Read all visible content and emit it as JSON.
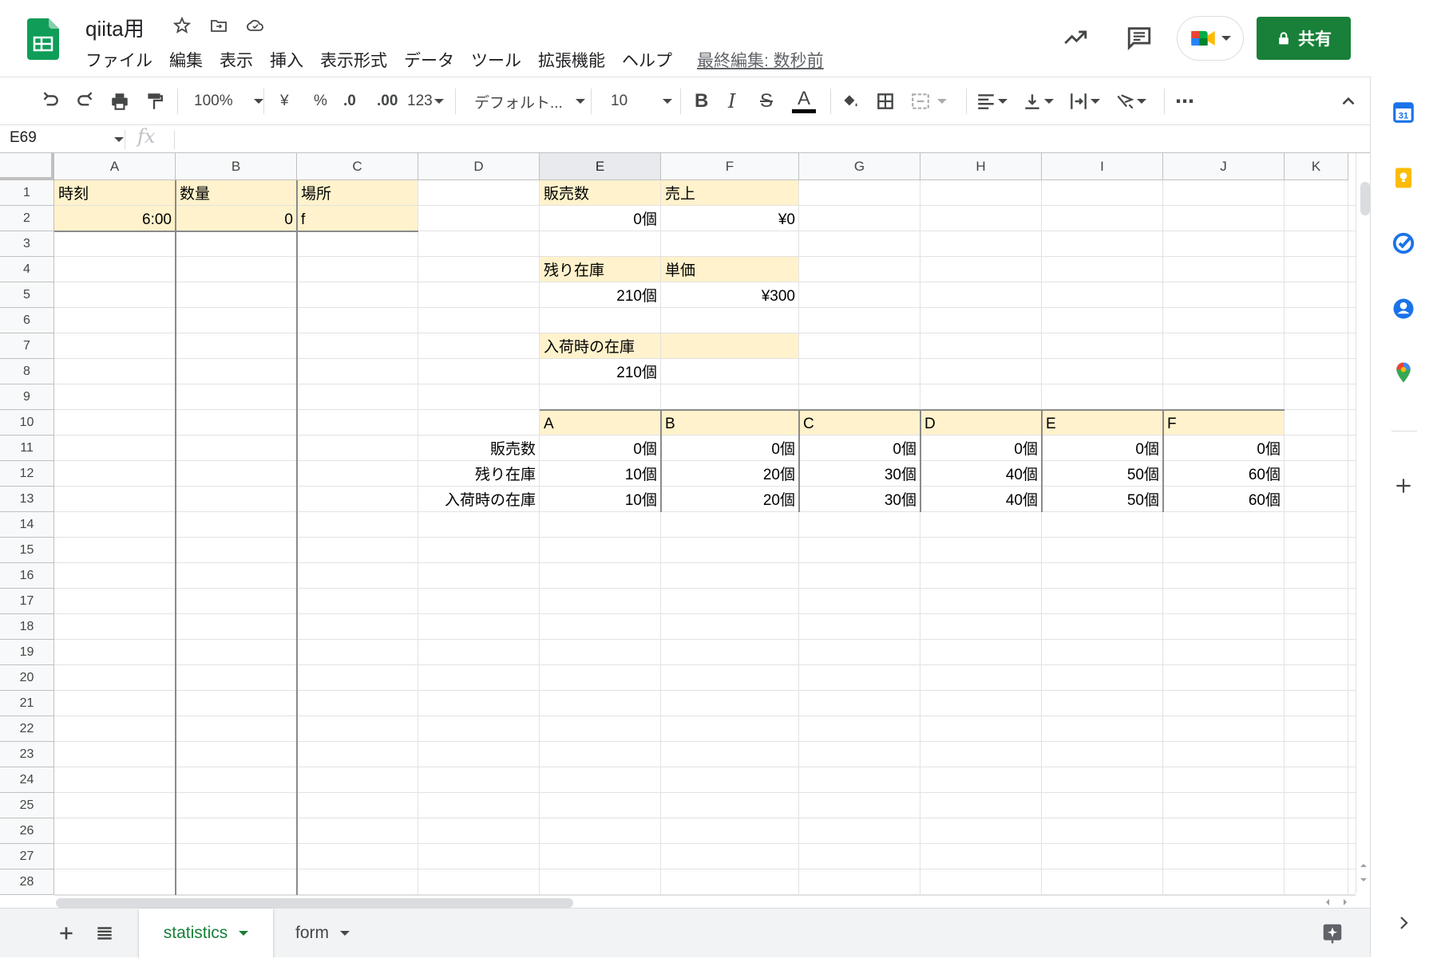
{
  "doc": {
    "title": "qiita用",
    "menu": [
      "ファイル",
      "編集",
      "表示",
      "挿入",
      "表示形式",
      "データ",
      "ツール",
      "拡張機能",
      "ヘルプ"
    ],
    "last_edit": "最終編集: 数秒前",
    "share_label": "共有"
  },
  "toolbar": {
    "zoom": "100%",
    "currency": "¥",
    "percent": "%",
    "dec_decrease": ".0",
    "dec_increase": ".00",
    "number_format": "123",
    "font": "デフォルト...",
    "font_size": "10",
    "bold": "B",
    "italic": "I",
    "strike": "S",
    "text_color": "A",
    "more": "⋯"
  },
  "formula_bar": {
    "cell_ref": "E69",
    "fx": "fx"
  },
  "columns": [
    "A",
    "B",
    "C",
    "D",
    "E",
    "F",
    "G",
    "H",
    "I",
    "J",
    "K"
  ],
  "rows": [
    "1",
    "2",
    "3",
    "4",
    "5",
    "6",
    "7",
    "8",
    "9",
    "10",
    "11",
    "12",
    "13",
    "14",
    "15",
    "16",
    "17",
    "18",
    "19",
    "20",
    "21",
    "22",
    "23",
    "24",
    "25",
    "26",
    "27",
    "28"
  ],
  "cells": {
    "A1": "時刻",
    "B1": "数量",
    "C1": "場所",
    "A2": "6:00",
    "B2": "0",
    "C2": "f",
    "E1": "販売数",
    "F1": "売上",
    "E2": "0個",
    "F2": "¥0",
    "E4": "残り在庫",
    "F4": "単価",
    "E5": "210個",
    "F5": "¥300",
    "E7": "入荷時の在庫",
    "E8": "210個",
    "E10": "A",
    "F10": "B",
    "G10": "C",
    "H10": "D",
    "I10": "E",
    "J10": "F",
    "D11": "販売数",
    "D12": "残り在庫",
    "D13": "入荷時の在庫",
    "E11": "0個",
    "F11": "0個",
    "G11": "0個",
    "H11": "0個",
    "I11": "0個",
    "J11": "0個",
    "E12": "10個",
    "F12": "20個",
    "G12": "30個",
    "H12": "40個",
    "I12": "50個",
    "J12": "60個",
    "E13": "10個",
    "F13": "20個",
    "G13": "30個",
    "H13": "40個",
    "I13": "50個",
    "J13": "60個"
  },
  "sheets": [
    {
      "name": "statistics",
      "active": true
    },
    {
      "name": "form",
      "active": false
    }
  ],
  "colors": {
    "accent": "#188038",
    "highlight": "#fff2cc"
  }
}
